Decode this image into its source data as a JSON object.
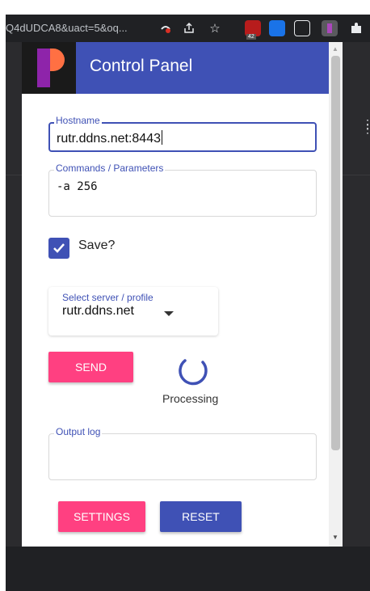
{
  "browser": {
    "url_fragment": "Q4dUDCA8&uact=5&oq...",
    "icons": [
      "incognito-blocked-icon",
      "share-icon",
      "star-icon",
      "ublock-icon",
      "translate-icon",
      "reader-icon",
      "extension-popup-icon",
      "puzzle-icon"
    ],
    "ublock_badge": "42"
  },
  "popup": {
    "title": "Control Panel",
    "hostname": {
      "label": "Hostname",
      "value": "rutr.ddns.net:8443"
    },
    "commands": {
      "label": "Commands / Parameters",
      "value": "-a 256"
    },
    "save": {
      "label": "Save?",
      "checked": true
    },
    "server_select": {
      "label": "Select server / profile",
      "value": "rutr.ddns.net"
    },
    "send_label": "SEND",
    "status_text": "Processing",
    "output": {
      "label": "Output log",
      "value": ""
    },
    "settings_label": "SETTINGS",
    "reset_label": "RESET"
  },
  "colors": {
    "primary": "#3f51b5",
    "accent": "#ff4081",
    "browser_bg": "#202124"
  }
}
